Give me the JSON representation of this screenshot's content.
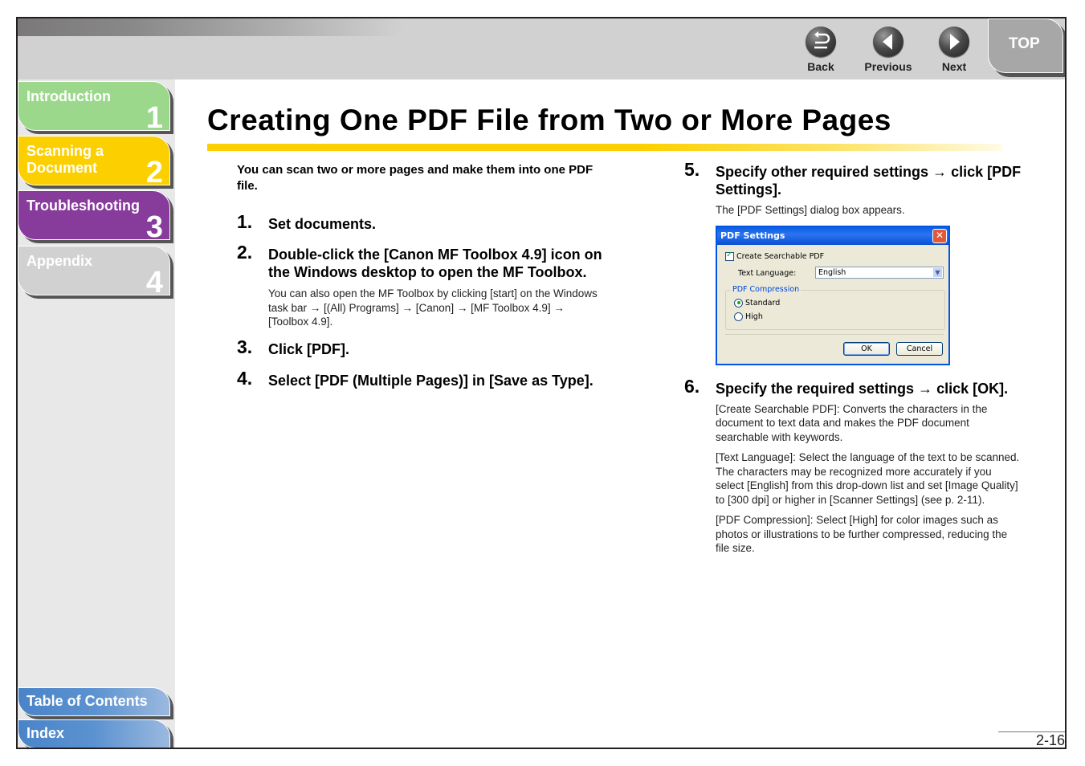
{
  "header": {
    "nav": [
      {
        "id": "back",
        "label": "Back",
        "icon": "back-arrow-icon"
      },
      {
        "id": "previous",
        "label": "Previous",
        "icon": "triangle-left-icon"
      },
      {
        "id": "next",
        "label": "Next",
        "icon": "triangle-right-icon"
      }
    ],
    "top_label": "TOP"
  },
  "sidebar": {
    "chapters": [
      {
        "label": "Introduction",
        "number": "1",
        "color": "#9bd88c"
      },
      {
        "label": "Scanning a Document",
        "line1": "Scanning a",
        "line2": "Document",
        "number": "2",
        "color": "#fcd000"
      },
      {
        "label": "Troubleshooting",
        "number": "3",
        "color": "#873c9c"
      },
      {
        "label": "Appendix",
        "number": "4",
        "color": "#d1d1d1"
      }
    ],
    "toc_label": "Table of Contents",
    "index_label": "Index"
  },
  "page": {
    "title": "Creating One PDF File from Two or More Pages",
    "intro": "You can scan two or more pages and make them into one PDF file.",
    "steps": [
      {
        "number": "1.",
        "heading": "Set documents."
      },
      {
        "number": "2.",
        "heading": "Double-click the [Canon MF Toolbox 4.9] icon on the Windows desktop to open the MF Toolbox.",
        "body": "You can also open the MF Toolbox by clicking [start] on the Windows task bar → [(All) Programs] → [Canon] → [MF Toolbox 4.9] → [Toolbox 4.9]."
      },
      {
        "number": "3.",
        "heading": "Click [PDF]."
      },
      {
        "number": "4.",
        "heading": "Select [PDF (Multiple Pages)] in [Save as Type]."
      },
      {
        "number": "5.",
        "heading": "Specify other required settings → click [PDF Settings].",
        "body": "The [PDF Settings] dialog box appears."
      },
      {
        "number": "6.",
        "heading": "Specify the required settings → click [OK].",
        "paragraphs": [
          "[Create Searchable PDF]: Converts the characters in the document to text data and makes the PDF document searchable with keywords.",
          "[Text Language]: Select the language of the text to be scanned. The characters may be recognized more accurately if you select [English] from this drop-down list and set [Image Quality] to [300 dpi] or higher in [Scanner Settings] (see p. 2-11).",
          "[PDF Compression]: Select [High] for color images such as photos or illustrations to be further compressed, reducing the file size."
        ]
      }
    ],
    "page_number": "2-16"
  },
  "dialog": {
    "title": "PDF Settings",
    "close_glyph": "✕",
    "searchable_label": "Create Searchable PDF",
    "searchable_checked": true,
    "language_label": "Text Language:",
    "language_value": "English",
    "compression_group": "PDF Compression",
    "compression_options": [
      "Standard",
      "High"
    ],
    "compression_selected": "Standard",
    "ok_label": "OK",
    "cancel_label": "Cancel"
  }
}
